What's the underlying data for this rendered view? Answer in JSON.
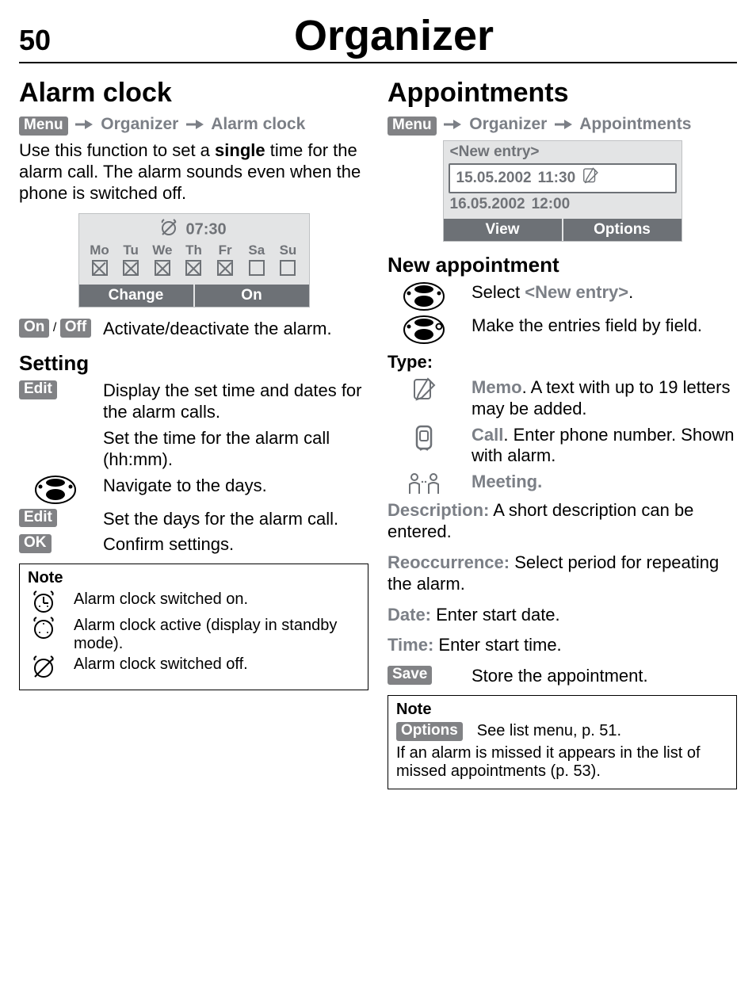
{
  "page": {
    "number": "50",
    "title": "Organizer"
  },
  "chips": {
    "menu": "Menu",
    "on": "On",
    "off": "Off",
    "edit": "Edit",
    "ok": "OK",
    "save": "Save",
    "options": "Options"
  },
  "left": {
    "title": "Alarm clock",
    "crumb": {
      "a": "Organizer",
      "b": "Alarm clock"
    },
    "intro_a": "Use this function to set a ",
    "intro_b": "single",
    "intro_c": " time for the alarm call. The alarm sounds even when the phone is switched off.",
    "phone": {
      "time": "07:30",
      "days": [
        {
          "label": "Mo",
          "checked": true
        },
        {
          "label": "Tu",
          "checked": true
        },
        {
          "label": "We",
          "checked": true
        },
        {
          "label": "Th",
          "checked": true
        },
        {
          "label": "Fr",
          "checked": true
        },
        {
          "label": "Sa",
          "checked": false
        },
        {
          "label": "Su",
          "checked": false
        }
      ],
      "soft_left": "Change",
      "soft_right": "On"
    },
    "onoff_sep": " / ",
    "onoff_desc": "Activate/deactivate the alarm.",
    "setting_title": "Setting",
    "edit1_desc": "Display the set time and dates for the alarm calls.",
    "set_time_desc": "Set the time for the alarm call (hh:mm).",
    "nav_desc": "Navigate to the days.",
    "edit2_desc": "Set the days for the alarm call.",
    "ok_desc": "Confirm settings.",
    "note": {
      "title": "Note",
      "on": "Alarm clock switched on.",
      "active": "Alarm clock active (display in standby mode).",
      "off": "Alarm clock switched off."
    }
  },
  "right": {
    "title": "Appointments",
    "crumb": {
      "a": "Organizer",
      "b": "Appointments"
    },
    "phone": {
      "new_entry": "<New entry>",
      "row1_date": "15.05.2002",
      "row1_time": "11:30",
      "row2_date": "16.05.2002",
      "row2_time": "12:00",
      "soft_left": "View",
      "soft_right": "Options"
    },
    "new_title": "New appointment",
    "step1_a": "Select ",
    "step1_b": "<New entry>",
    "step1_c": ".",
    "step2": "Make the entries field by field.",
    "type_label": "Type:",
    "memo_a": "Memo",
    "memo_b": ". A text with up to 19 letters may be added.",
    "call_a": "Call",
    "call_b": ". Enter phone number. Shown with alarm.",
    "meeting": "Meeting.",
    "desc_label": "Description:",
    "desc_text": " A short description can be entered.",
    "reocc_label": "Reoccurrence:",
    "reocc_text": " Select period for repeating the alarm.",
    "date_label": "Date:",
    "date_text": " Enter start date.",
    "time_label": "Time:",
    "time_text": " Enter start time.",
    "save_desc": "Store the appointment.",
    "note": {
      "title": "Note",
      "options_text": "See list menu, p. 51.",
      "miss": "If an alarm is missed it appears in the list of missed appointments (p. 53)."
    }
  }
}
